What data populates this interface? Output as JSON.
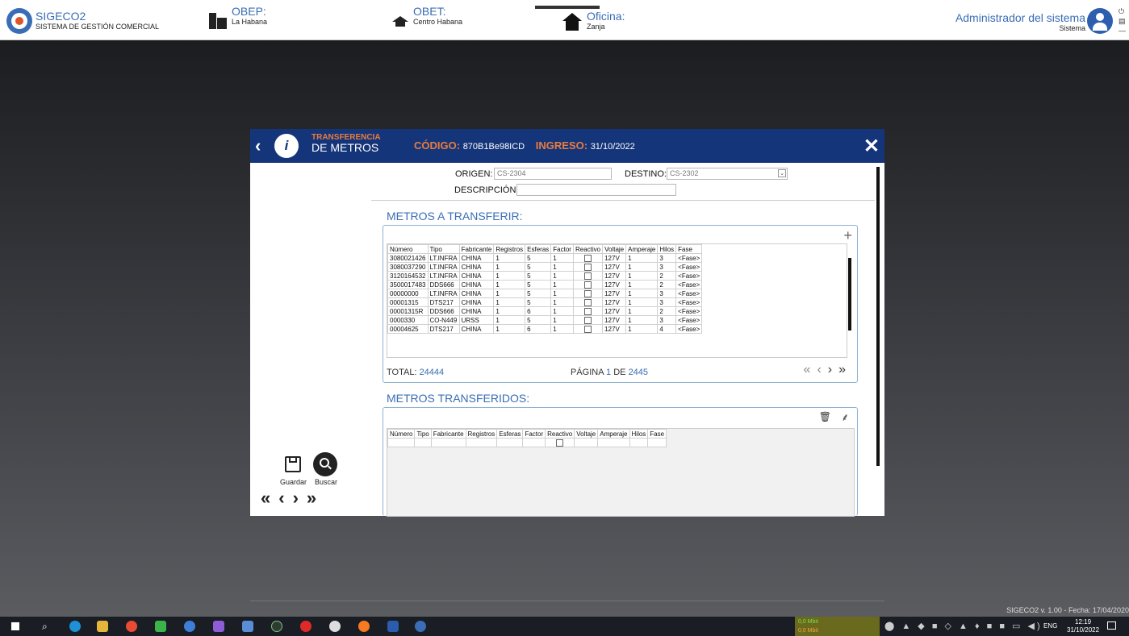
{
  "app": {
    "name": "SIGECO2",
    "subtitle": "SISTEMA DE GESTIÓN COMERCIAL"
  },
  "header": {
    "obep_label": "OBEP:",
    "obep_value": "La Habana",
    "obet_label": "OBET:",
    "obet_value": "Centro Habana",
    "oficina_label": "Oficina:",
    "oficina_value": "Zanja",
    "user": "Administrador del sistema",
    "user_role": "Sistema"
  },
  "dialog": {
    "title_top": "TRANSFERENCIA",
    "title_bottom": "DE METROS",
    "codigo_label": "CÓDIGO:",
    "codigo_value": "870B1Be98ICD",
    "ingreso_label": "INGRESO:",
    "ingreso_value": "31/10/2022",
    "origen_label": "ORIGEN:",
    "origen_value": "CS-2304",
    "destino_label": "DESTINO:",
    "destino_value": "CS-2302",
    "descripcion_label": "DESCRIPCIÓN:",
    "descripcion_value": ""
  },
  "metros_a_transferir": {
    "title": "METROS A TRANSFERIR:",
    "columns": [
      "Número",
      "Tipo",
      "Fabricante",
      "Registros",
      "Esferas",
      "Factor",
      "Reactivo",
      "Voltaje",
      "Amperaje",
      "Hilos",
      "Fase"
    ],
    "rows": [
      [
        "3080021426",
        "LT.INFRA",
        "CHINA",
        "1",
        "5",
        "1",
        "",
        "127V",
        "1",
        "3",
        "<Fase>"
      ],
      [
        "3080037290",
        "LT.INFRA",
        "CHINA",
        "1",
        "5",
        "1",
        "",
        "127V",
        "1",
        "3",
        "<Fase>"
      ],
      [
        "3120164532",
        "LT.INFRA",
        "CHINA",
        "1",
        "5",
        "1",
        "",
        "127V",
        "1",
        "2",
        "<Fase>"
      ],
      [
        "3500017483",
        "DDS666",
        "CHINA",
        "1",
        "5",
        "1",
        "",
        "127V",
        "1",
        "2",
        "<Fase>"
      ],
      [
        "00000000",
        "LT.INFRA",
        "CHINA",
        "1",
        "5",
        "1",
        "",
        "127V",
        "1",
        "3",
        "<Fase>"
      ],
      [
        "00001315",
        "DTS217",
        "CHINA",
        "1",
        "5",
        "1",
        "",
        "127V",
        "1",
        "3",
        "<Fase>"
      ],
      [
        "00001315R",
        "DDS666",
        "CHINA",
        "1",
        "6",
        "1",
        "",
        "127V",
        "1",
        "2",
        "<Fase>"
      ],
      [
        "0000330",
        "CO-N449",
        "URSS",
        "1",
        "5",
        "1",
        "",
        "127V",
        "1",
        "3",
        "<Fase>"
      ],
      [
        "00004625",
        "DTS217",
        "CHINA",
        "1",
        "6",
        "1",
        "",
        "127V",
        "1",
        "4",
        "<Fase>"
      ]
    ],
    "total_label": "TOTAL:",
    "total_value": "24444",
    "page_label": "PÁGINA",
    "page_value": "1",
    "page_of": "DE",
    "page_total": "2445"
  },
  "metros_transferidos": {
    "title": "METROS TRANSFERIDOS:",
    "columns": [
      "Número",
      "Tipo",
      "Fabricante",
      "Registros",
      "Esferas",
      "Factor",
      "Reactivo",
      "Voltaje",
      "Amperaje",
      "Hilos",
      "Fase"
    ]
  },
  "side": {
    "guardar": "Guardar",
    "buscar": "Buscar"
  },
  "footer": {
    "version": "SIGECO2 v. 1.00 - Fecha: 17/04/2020"
  },
  "taskbar": {
    "net_up": "0,0 Mbit",
    "net_down": "0,0 Mbit",
    "lang": "ENG",
    "time": "12:19",
    "date": "31/10/2022"
  }
}
